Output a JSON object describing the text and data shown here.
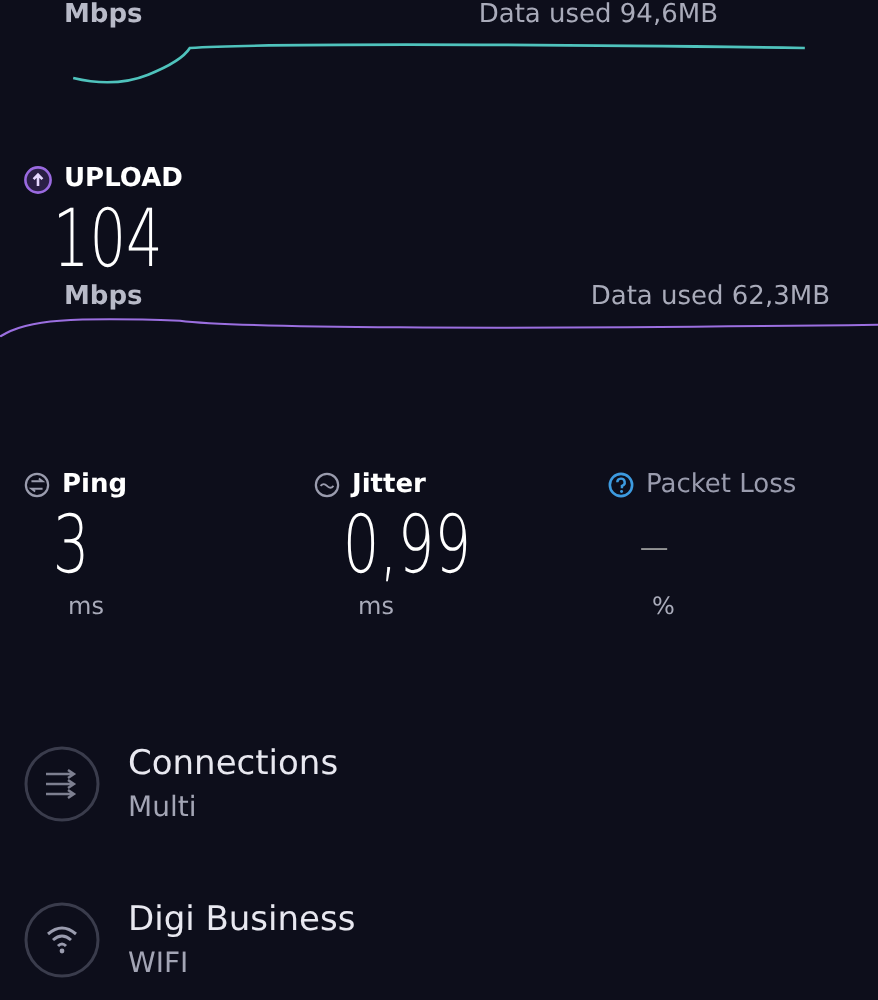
{
  "download": {
    "unit": "Mbps",
    "data_used": "Data used 94,6MB"
  },
  "upload": {
    "label": "UPLOAD",
    "value": "104",
    "unit": "Mbps",
    "data_used": "Data used 62,3MB"
  },
  "stats": [
    {
      "kind": "ping",
      "label": "Ping",
      "value": "3",
      "unit": "ms"
    },
    {
      "kind": "jitter",
      "label": "Jitter",
      "value": "0,99",
      "unit": "ms"
    },
    {
      "kind": "loss",
      "label": "Packet Loss",
      "value": "—",
      "unit": "%"
    }
  ],
  "details": [
    {
      "kind": "connections",
      "title": "Connections",
      "subtitle": "Multi"
    },
    {
      "kind": "wifi",
      "title": "Digi Business",
      "subtitle": "WIFI"
    }
  ]
}
